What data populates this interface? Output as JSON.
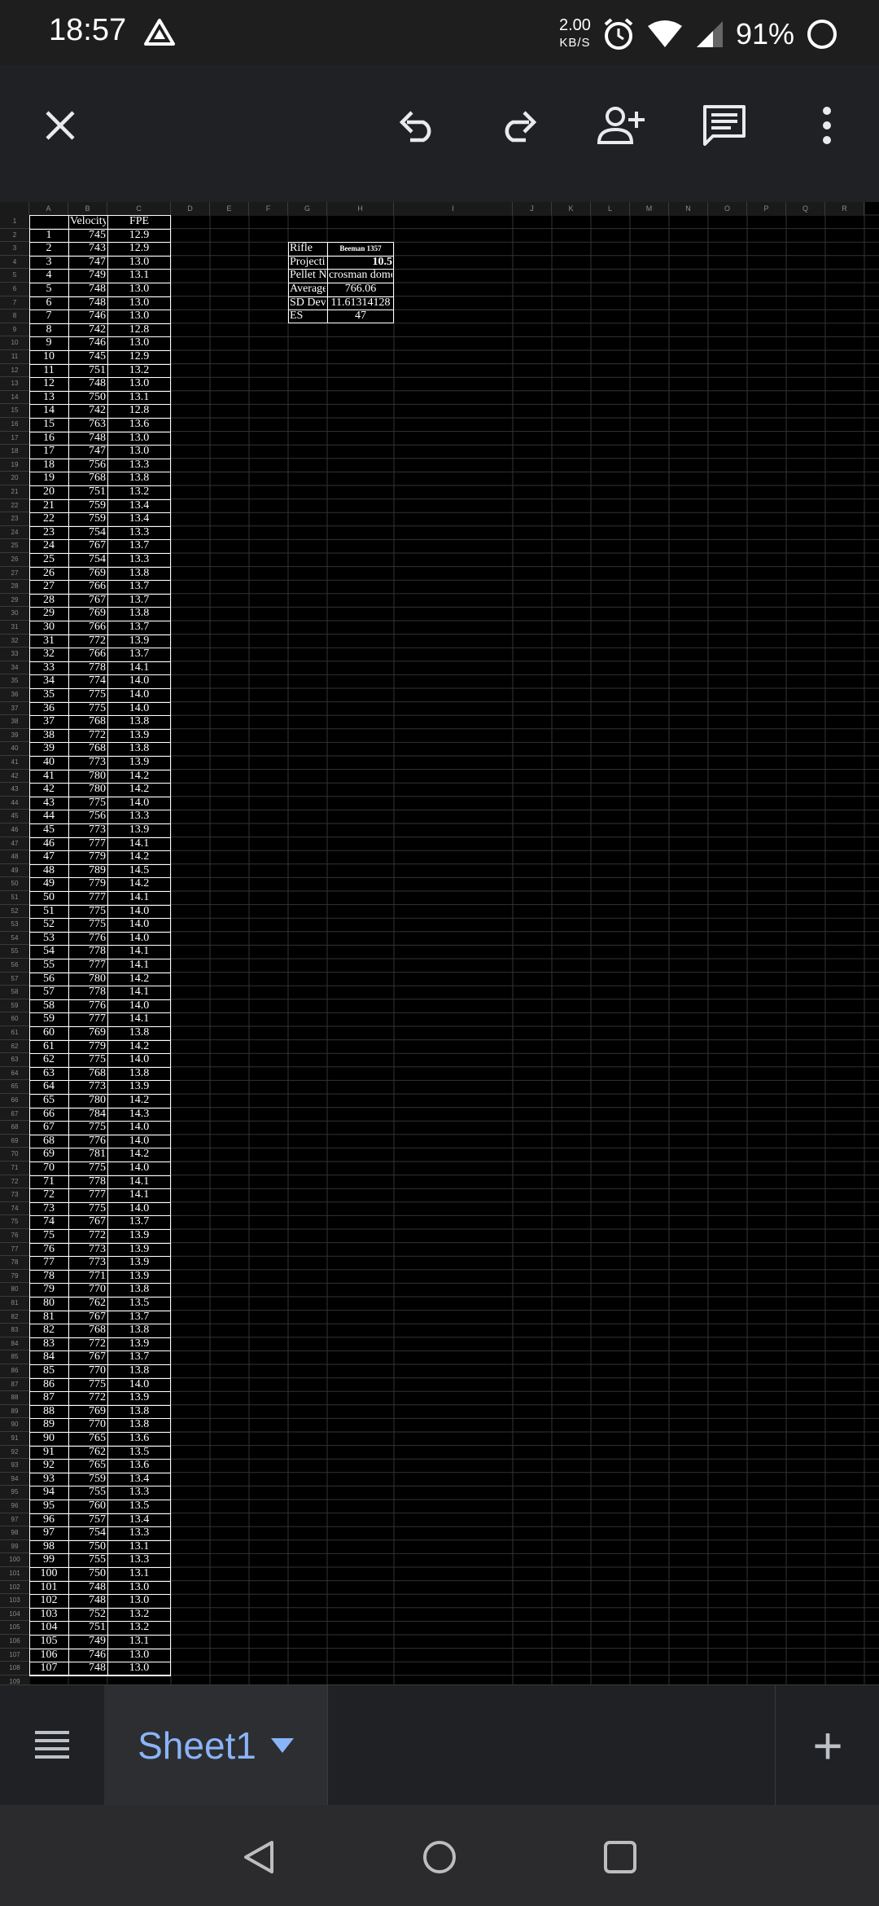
{
  "status": {
    "time": "18:57",
    "net_speed": "2.00",
    "net_unit": "KB/S",
    "battery": "91%"
  },
  "toolbar": {
    "icons": [
      "close-icon",
      "undo-icon",
      "redo-icon",
      "add-person-icon",
      "comment-icon",
      "more-vert-icon"
    ]
  },
  "sheet": {
    "columns": [
      "A",
      "B",
      "C",
      "D",
      "E",
      "F",
      "G",
      "H",
      "I",
      "J",
      "K",
      "L",
      "M",
      "N",
      "O",
      "P",
      "Q",
      "R"
    ],
    "header_velocity": "Velocity",
    "header_fpe": "FPE",
    "velocities": [
      745,
      743,
      747,
      749,
      748,
      748,
      746,
      742,
      746,
      745,
      751,
      748,
      750,
      742,
      763,
      748,
      747,
      756,
      768,
      751,
      759,
      759,
      754,
      767,
      754,
      769,
      766,
      767,
      769,
      766,
      772,
      766,
      778,
      774,
      775,
      775,
      768,
      772,
      768,
      773,
      780,
      780,
      775,
      756,
      773,
      777,
      779,
      789,
      779,
      777,
      775,
      775,
      776,
      778,
      777,
      780,
      778,
      776,
      777,
      769,
      779,
      775,
      768,
      773,
      780,
      784,
      775,
      776,
      781,
      775,
      778,
      777,
      775,
      767,
      772,
      773,
      773,
      771,
      770,
      762,
      767,
      768,
      772,
      767,
      770,
      775,
      772,
      769,
      770,
      765,
      762,
      765,
      759,
      755,
      760,
      757,
      754,
      750,
      755,
      750,
      748,
      748,
      752,
      751,
      749,
      746,
      748
    ],
    "fpe": [
      "12.9",
      "12.9",
      "13.0",
      "13.1",
      "13.0",
      "13.0",
      "13.0",
      "12.8",
      "13.0",
      "12.9",
      "13.2",
      "13.0",
      "13.1",
      "12.8",
      "13.6",
      "13.0",
      "13.0",
      "13.3",
      "13.8",
      "13.2",
      "13.4",
      "13.4",
      "13.3",
      "13.7",
      "13.3",
      "13.8",
      "13.7",
      "13.7",
      "13.8",
      "13.7",
      "13.9",
      "13.7",
      "14.1",
      "14.0",
      "14.0",
      "14.0",
      "13.8",
      "13.9",
      "13.8",
      "13.9",
      "14.2",
      "14.2",
      "14.0",
      "13.3",
      "13.9",
      "14.1",
      "14.2",
      "14.5",
      "14.2",
      "14.1",
      "14.0",
      "14.0",
      "14.0",
      "14.1",
      "14.1",
      "14.2",
      "14.1",
      "14.0",
      "14.1",
      "13.8",
      "14.2",
      "14.0",
      "13.8",
      "13.9",
      "14.2",
      "14.3",
      "14.0",
      "14.0",
      "14.2",
      "14.0",
      "14.1",
      "14.1",
      "14.0",
      "13.7",
      "13.9",
      "13.9",
      "13.9",
      "13.9",
      "13.8",
      "13.5",
      "13.7",
      "13.8",
      "13.9",
      "13.7",
      "13.8",
      "14.0",
      "13.9",
      "13.8",
      "13.8",
      "13.6",
      "13.5",
      "13.6",
      "13.4",
      "13.3",
      "13.5",
      "13.4",
      "13.3",
      "13.1",
      "13.3",
      "13.1",
      "13.0",
      "13.0",
      "13.2",
      "13.2",
      "13.1",
      "13.0",
      "13.0"
    ],
    "summary": [
      {
        "label": "Rifle",
        "value": "Beeman 1357"
      },
      {
        "label": "Projectile Gra",
        "value": "10.5"
      },
      {
        "label": "Pellet Name",
        "value": "crosman domed"
      },
      {
        "label": "Average",
        "value": "766.06"
      },
      {
        "label": "SD Dev",
        "value": "11.61314128"
      },
      {
        "label": "ES",
        "value": "47"
      }
    ]
  },
  "bottom": {
    "sheet_name": "Sheet1",
    "add_label": "+"
  }
}
